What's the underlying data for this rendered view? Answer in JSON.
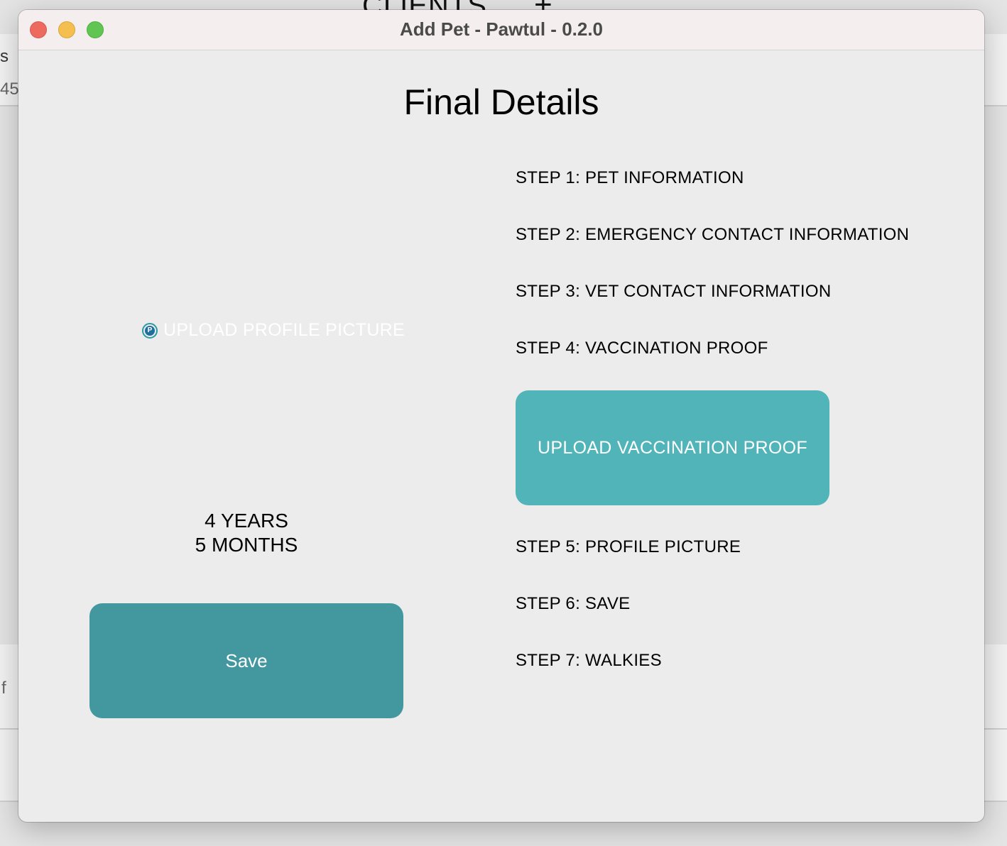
{
  "background_app": {
    "title": "CLIENTS",
    "add_symbol": "+",
    "fragment_top": "s",
    "fragment_number": "45",
    "fragment_mid": "f"
  },
  "window": {
    "title": "Add Pet - Pawtul - 0.2.0",
    "traffic_lights": {
      "close_color": "#ec6a5e",
      "minimize_color": "#f4bf4f",
      "maximize_color": "#61c554"
    }
  },
  "page": {
    "title": "Final Details"
  },
  "profile_picture": {
    "upload_label": "UPLOAD PROFILE PICTURE",
    "icon": "picture-upload-icon",
    "icon_glyph": "P"
  },
  "age": {
    "years": "4 YEARS",
    "months": "5 MONTHS"
  },
  "save_button": {
    "label": "Save",
    "color": "#4398a0"
  },
  "steps": [
    "STEP 1: PET INFORMATION",
    "STEP 2: EMERGENCY CONTACT INFORMATION",
    "STEP 3: VET CONTACT INFORMATION",
    "STEP 4: VACCINATION PROOF",
    "STEP 5: PROFILE PICTURE",
    "STEP 6: SAVE",
    "STEP 7: WALKIES"
  ],
  "vaccination_button": {
    "label": "UPLOAD VACCINATION PROOF",
    "color": "#51b4b9"
  }
}
